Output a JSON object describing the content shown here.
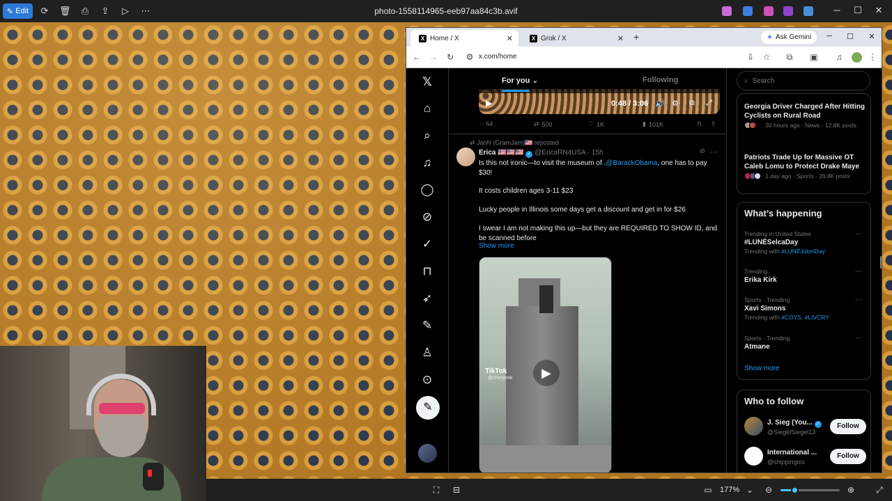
{
  "photos_app": {
    "edit_label": "Edit",
    "file_name": "photo-1558114965-eeb97aa84c3b.avif",
    "zoom": "177%"
  },
  "browser": {
    "tabs": [
      {
        "label": "Home / X",
        "active": true
      },
      {
        "label": "Grok / X",
        "active": false
      }
    ],
    "ask_gemini": "Ask Gemini",
    "url": "x.com/home"
  },
  "x": {
    "feed_tabs": {
      "for_you": "For you",
      "following": "Following"
    },
    "video": {
      "time": "0:48 / 3:06"
    },
    "prev_actions": {
      "replies": "64",
      "reposts": "500",
      "likes": "1K",
      "views": "101K"
    },
    "post": {
      "repost_line": "JanN (GramJam)🇺🇸 reposted",
      "name": "Erica 🇺🇸🇺🇸🇺🇸",
      "handle": "@EricaRN4USA",
      "time": "· 15h",
      "text1_a": "Is this not ironic—to visit the museum of .",
      "text1_mention": "@BarackObama",
      "text1_b": ", one has to pay $30!",
      "text2": "It costs children ages 3-11 $23",
      "text3": "Lucky people in Illinois some days get a discount and get in for $26",
      "text4": "I swear I am not making this up—but they are REQUIRED TO SHOW ID, and be scanned before",
      "show_more": "Show more",
      "media_watermark": "TikTok",
      "media_watermark_sub": "@cherjemk"
    },
    "search_placeholder": "Search",
    "news": [
      {
        "title": "Georgia Driver Charged After Hitting Cyclists on Rural Road",
        "meta": "20 hours ago · News · 12.8K posts"
      },
      {
        "title": "Patriots Trade Up for Massive OT Caleb Lomu to Protect Drake Maye",
        "meta": "1 day ago · Sports · 26.8K posts"
      }
    ],
    "whats_happening": {
      "title": "What’s happening",
      "trends": [
        {
          "context": "Trending in United States",
          "name": "#LUNÉSelcaDay",
          "with_label": "Trending with",
          "with": "#LUNÉJidoriDay"
        },
        {
          "context": "Trending",
          "name": "Erika Kirk",
          "with_label": "",
          "with": ""
        },
        {
          "context": "Sports · Trending",
          "name": "Xavi Simons",
          "with_label": "Trending with",
          "with": "#COYS, #LIVCRY"
        },
        {
          "context": "Sports · Trending",
          "name": "Atmane",
          "with_label": "",
          "with": ""
        }
      ],
      "show_more": "Show more"
    },
    "who_to_follow": {
      "title": "Who to follow",
      "accounts": [
        {
          "name": "J. Sieg (You...",
          "handle": "@SiegelSiegel13",
          "button": "Follow"
        },
        {
          "name": "International ...",
          "handle": "@shippingics",
          "button": "Follow"
        }
      ]
    }
  },
  "colors": {
    "accent": "#1d9bf0",
    "photos_accent": "#2d7ad6"
  }
}
